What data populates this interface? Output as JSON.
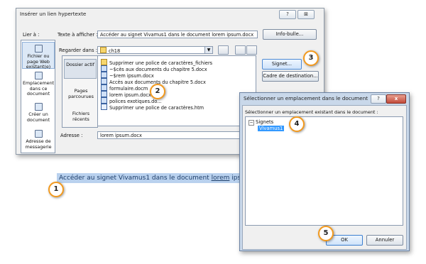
{
  "hyperlink_dialog": {
    "title": "Insérer un lien hypertexte",
    "help_btn": "?",
    "close_btn": "⊠",
    "link_to_label": "Lier à :",
    "text_to_display_label": "Texte à afficher :",
    "text_to_display_value": "Accéder au signet Vivamus1 dans le document lorem ipsum.docx",
    "screentip_btn": "Info-bulle...",
    "look_in_label": "Regarder dans :",
    "look_in_value": "ch18",
    "nav": [
      {
        "label": "Fichier ou page Web existant(e)"
      },
      {
        "label": "Emplacement dans ce document"
      },
      {
        "label": "Créer un document"
      },
      {
        "label": "Adresse de messagerie"
      }
    ],
    "side_buttons": [
      {
        "label": "Dossier actif"
      },
      {
        "label": "Pages parcourues"
      },
      {
        "label": "Fichiers récents"
      }
    ],
    "files": [
      {
        "name": "Supprimer une police de caractères_fichiers",
        "icon": "folder-icon"
      },
      {
        "name": "~$cès aux documents du chapitre 5.docx",
        "icon": "word-doc-icon"
      },
      {
        "name": "~$rem ipsum.docx",
        "icon": "word-doc-icon"
      },
      {
        "name": "Accès aux documents du chapitre 5.docx",
        "icon": "word-doc-icon"
      },
      {
        "name": "formulaire.docm",
        "icon": "word-doc-icon"
      },
      {
        "name": "lorem ipsum.docx",
        "icon": "word-doc-icon"
      },
      {
        "name": "polices exotiques.do...",
        "icon": "word-doc-icon"
      },
      {
        "name": "Supprimer une police de caractères.htm",
        "icon": "html-doc-icon"
      }
    ],
    "bookmark_btn": "Signet...",
    "target_frame_btn": "Cadre de destination...",
    "address_label": "Adresse :",
    "address_value": "lorem ipsum.docx"
  },
  "bookmark_dialog": {
    "title": "Sélectionner un emplacement dans le document",
    "help_btn": "?",
    "close_btn": "x",
    "prompt": "Sélectionner un emplacement existant dans le document :",
    "tree_root": "Signets",
    "tree_child": "Vivamus1",
    "ok_btn": "OK",
    "cancel_btn": "Annuler"
  },
  "document": {
    "highlighted_text_before": "Accéder au signet Vivamus1 dans le document ",
    "highlighted_text_link": "lorem",
    "highlighted_text_after": " ipsu"
  },
  "callouts": [
    "1",
    "2",
    "3",
    "4",
    "5"
  ],
  "colors": {
    "callout_border": "#f39a1e",
    "selection_highlight": "#b9d1ee",
    "tree_selection": "#3399ff"
  }
}
